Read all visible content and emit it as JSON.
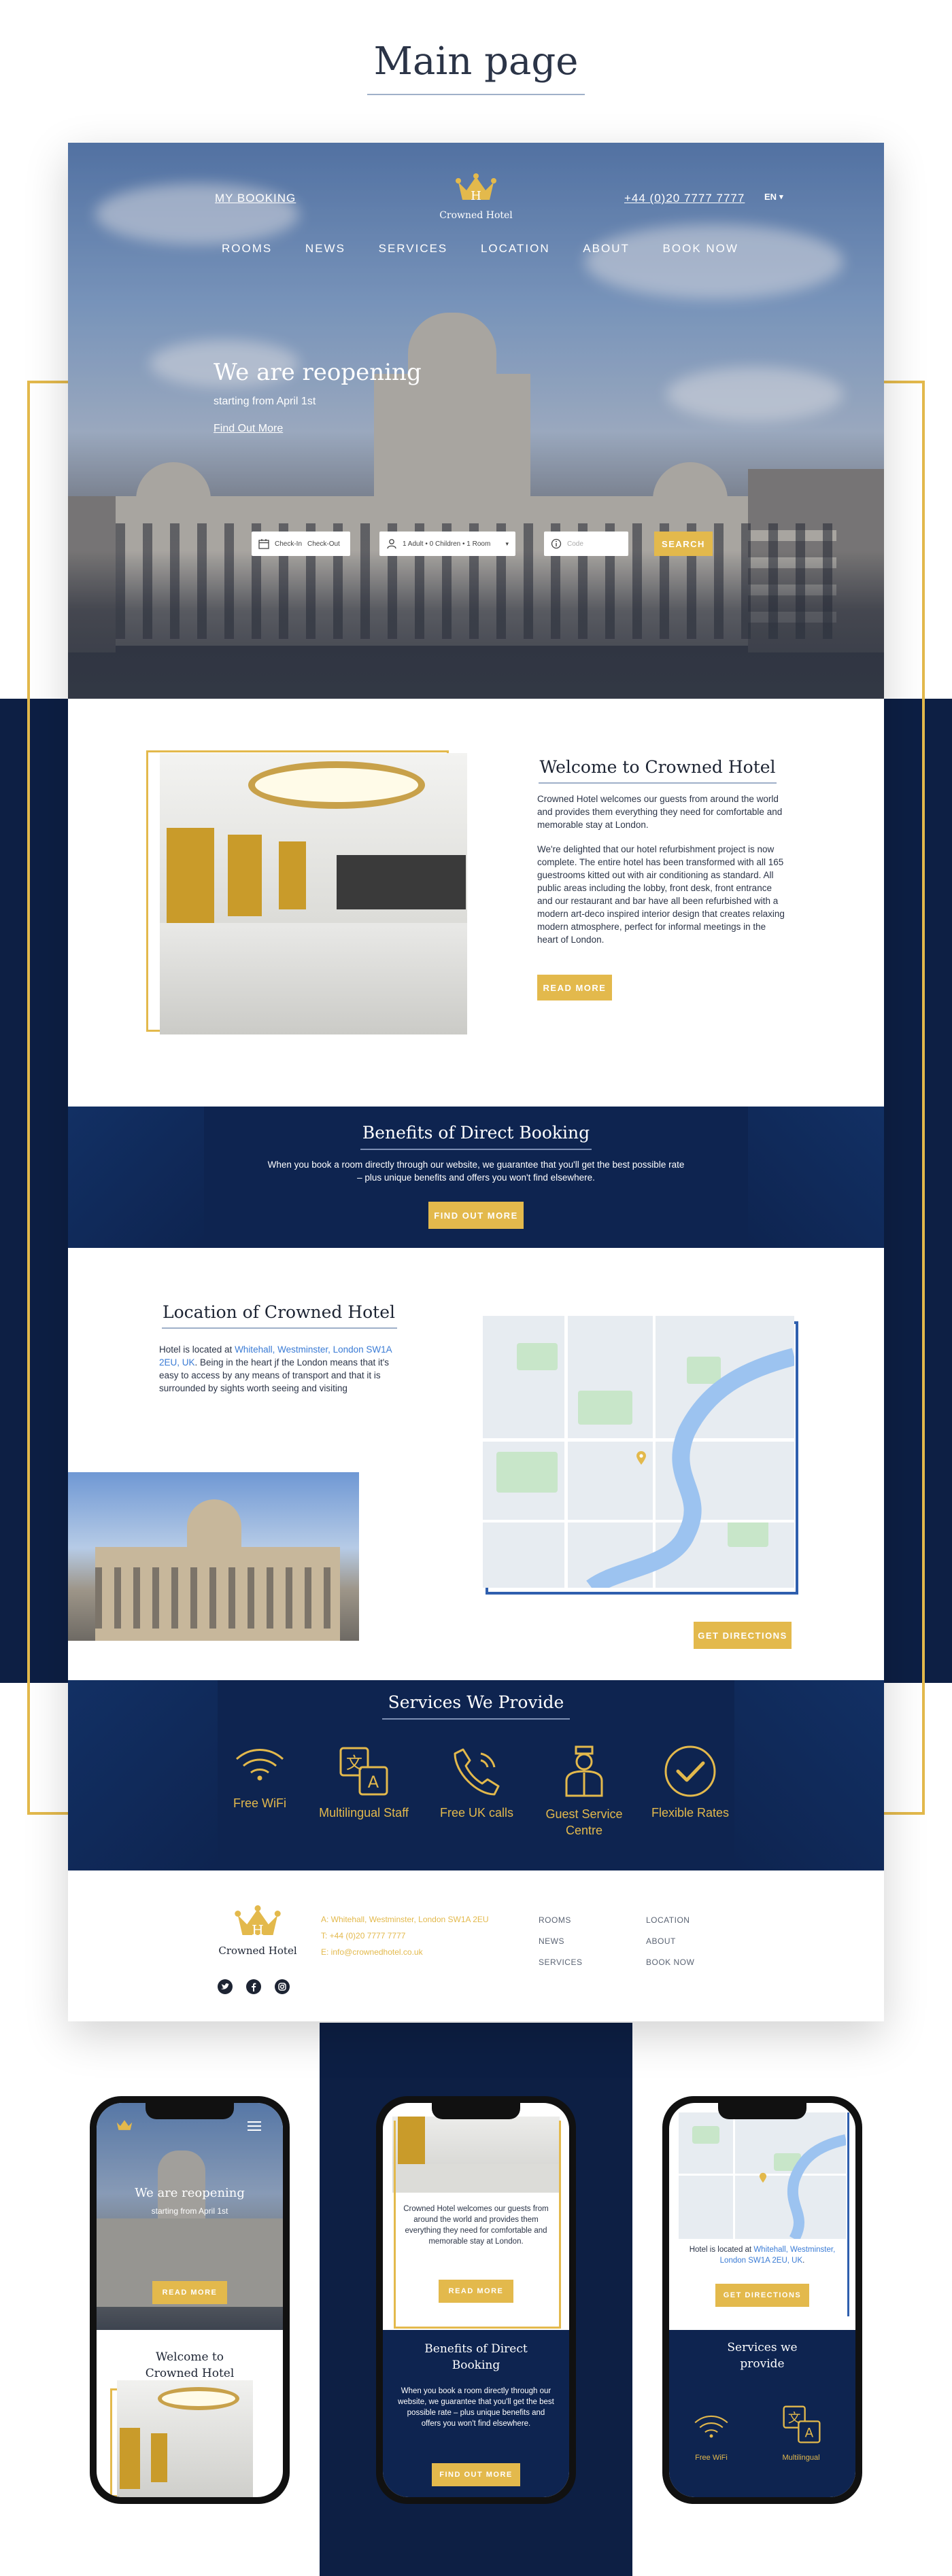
{
  "page": {
    "title": "Main page"
  },
  "colors": {
    "navy": "#0d1f44",
    "navy_light": "#0e2450",
    "gold": "#e3b94c",
    "white": "#ffffff",
    "text": "#1d2433"
  },
  "hero": {
    "my_booking": "MY BOOKING",
    "logo_text": "Crowned Hotel",
    "phone": "+44 (0)20 7777 7777",
    "lang": "EN",
    "nav": [
      "ROOMS",
      "NEWS",
      "SERVICES",
      "LOCATION",
      "ABOUT",
      "BOOK NOW"
    ],
    "headline": "We are reopening",
    "subline": "starting from April 1st",
    "cta_link": "Find Out More",
    "booking": {
      "check_in": "Check-In",
      "check_out": "Check-Out",
      "guests": "1 Adult • 0 Children • 1 Room",
      "code_placeholder": "Code",
      "search": "SEARCH"
    }
  },
  "welcome": {
    "title": "Welcome to Crowned Hotel",
    "para1": "Crowned Hotel welcomes our guests from around the world and provides them everything they need for comfortable and memorable stay at London.",
    "para2": "We're delighted that our hotel refurbishment project is now complete. The entire hotel has been transformed with all 165 guestrooms kitted out with air conditioning as standard. All public areas including the lobby, front desk, front entrance and our restaurant and bar have all been refurbished with a modern art-deco inspired interior design that creates relaxing modern atmosphere, perfect for informal meetings in the heart of London.",
    "button": "READ MORE"
  },
  "benefits": {
    "title": "Benefits of Direct Booking",
    "text": "When you book a room directly through our website, we guarantee that you'll get the best possible rate – plus unique benefits and offers you won't find elsewhere.",
    "button": "FIND OUT MORE"
  },
  "location": {
    "title": "Location of Crowned Hotel",
    "text_before": "Hotel is located at ",
    "address_link": "Whitehall, Westminster, London SW1A 2EU, UK",
    "text_after": ". Being in the heart jf the London means that it's easy to access by any means of transport and that it is surrounded by sights worth seeing and visiting",
    "button": "GET DIRECTIONS"
  },
  "services": {
    "title": "Services We Provide",
    "items": [
      {
        "label": "Free WiFi",
        "icon": "wifi-icon"
      },
      {
        "label": "Multilingual Staff",
        "icon": "translate-icon"
      },
      {
        "label": "Free UK calls",
        "icon": "phone-icon"
      },
      {
        "label": "Guest Service Centre",
        "icon": "concierge-icon"
      },
      {
        "label": "Flexible Rates",
        "icon": "checkmark-icon"
      }
    ]
  },
  "footer": {
    "logo_text": "Crowned Hotel",
    "address": "A: Whitehall, Westminster, London SW1A 2EU",
    "phone": "T: +44 (0)20 7777 7777",
    "email": "E: info@crownedhotel.co.uk",
    "links_col1": [
      "ROOMS",
      "NEWS",
      "SERVICES"
    ],
    "links_col2": [
      "LOCATION",
      "ABOUT",
      "BOOK NOW"
    ],
    "social": [
      "twitter-icon",
      "facebook-icon",
      "instagram-icon"
    ]
  },
  "mobile": {
    "phone1": {
      "headline": "We are reopening",
      "subline": "starting from April 1st",
      "button": "READ MORE",
      "welcome_title": "Welcome to Crowned Hotel"
    },
    "phone2": {
      "text": "Crowned Hotel welcomes our guests from around the world and provides them everything they need for comfortable and memorable stay at London.",
      "button": "READ MORE",
      "benefits_title": "Benefits of Direct Booking",
      "benefits_text": "When you book a room directly through our website, we guarantee that you'll get the best possible rate – plus unique benefits and offers you won't find elsewhere.",
      "button2": "FIND OUT MORE"
    },
    "phone3": {
      "text_before": "Hotel is located at ",
      "address_link": "Whitehall, Westminster, London SW1A 2EU, UK",
      "text_after": ".",
      "button": "GET DIRECTIONS",
      "services_title": "Services we provide",
      "service1": "Free WiFi",
      "service2": "Multilingual"
    }
  }
}
